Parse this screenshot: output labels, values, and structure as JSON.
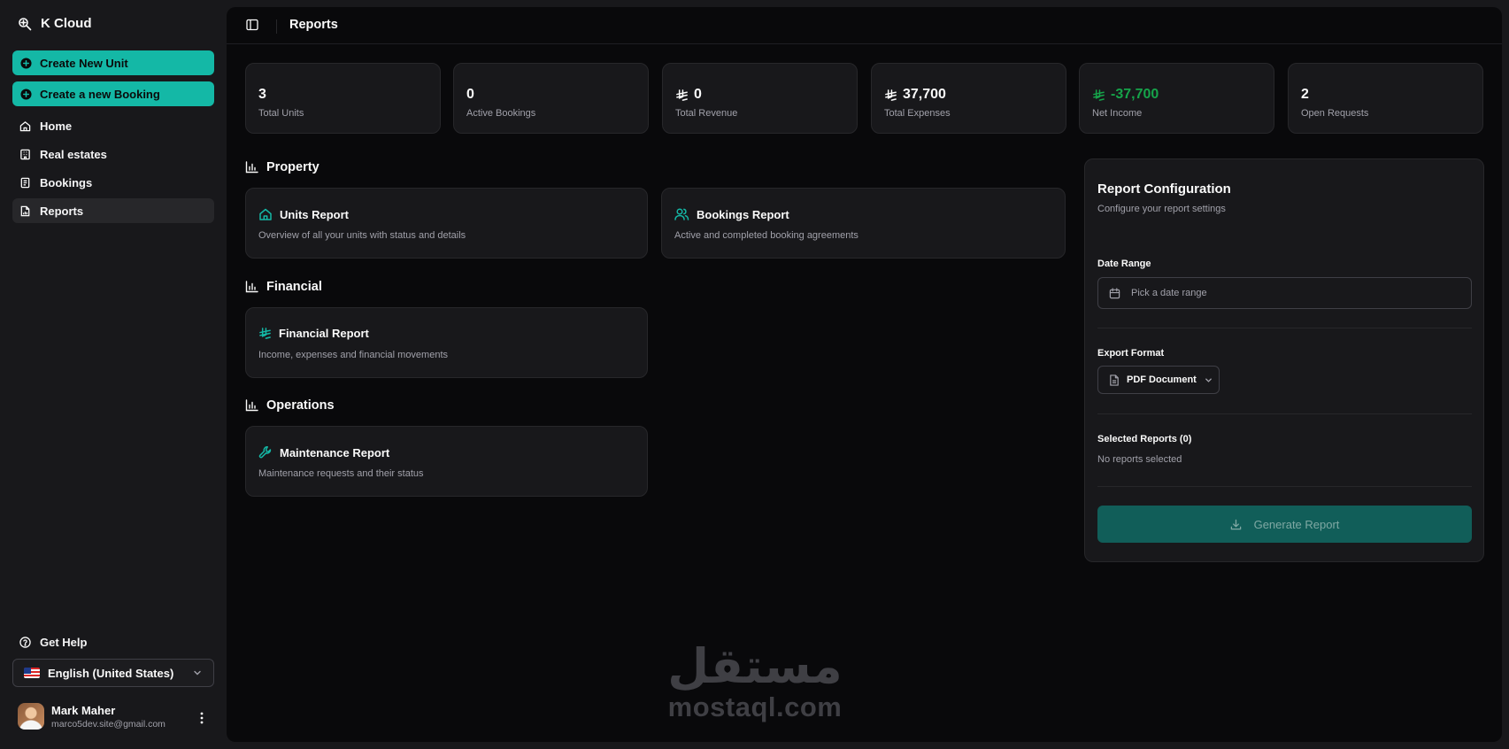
{
  "app": {
    "name": "K Cloud"
  },
  "sidebar": {
    "create_unit": "Create New Unit",
    "create_booking": "Create a new Booking",
    "items": [
      {
        "label": "Home",
        "icon": "house-icon"
      },
      {
        "label": "Real estates",
        "icon": "building-icon"
      },
      {
        "label": "Bookings",
        "icon": "book-icon"
      },
      {
        "label": "Reports",
        "icon": "report-icon",
        "active": true
      }
    ],
    "help": "Get Help",
    "language": "English (United States)",
    "user": {
      "name": "Mark Maher",
      "email": "marco5dev.site@gmail.com"
    }
  },
  "header": {
    "title": "Reports"
  },
  "stats": [
    {
      "value": "3",
      "label": "Total Units",
      "currency": false
    },
    {
      "value": "0",
      "label": "Active Bookings",
      "currency": false
    },
    {
      "value": "0",
      "label": "Total Revenue",
      "currency": true
    },
    {
      "value": "37,700",
      "label": "Total Expenses",
      "currency": true
    },
    {
      "value": "-37,700",
      "label": "Net Income",
      "currency": true,
      "color": "#16a34a"
    },
    {
      "value": "2",
      "label": "Open Requests",
      "currency": false
    }
  ],
  "sections": {
    "property": {
      "title": "Property",
      "cards": [
        {
          "title": "Units Report",
          "desc": "Overview of all your units with status and details",
          "icon": "house-icon"
        },
        {
          "title": "Bookings Report",
          "desc": "Active and completed booking agreements",
          "icon": "users-icon"
        }
      ]
    },
    "financial": {
      "title": "Financial",
      "cards": [
        {
          "title": "Financial Report",
          "desc": "Income, expenses and financial movements",
          "icon": "riyal-icon"
        }
      ]
    },
    "operations": {
      "title": "Operations",
      "cards": [
        {
          "title": "Maintenance Report",
          "desc": "Maintenance requests and their status",
          "icon": "wrench-icon"
        }
      ]
    }
  },
  "config": {
    "title": "Report Configuration",
    "subtitle": "Configure your report settings",
    "date_label": "Date Range",
    "date_placeholder": "Pick a date range",
    "format_label": "Export Format",
    "format_value": "PDF Document",
    "selected_label": "Selected Reports (0)",
    "selected_empty": "No reports selected",
    "generate": "Generate Report"
  },
  "watermark": {
    "arabic": "مستقل",
    "latin": "mostaql.com"
  },
  "colors": {
    "accent": "#14b8a6",
    "positive": "#16a34a",
    "background": "#09090b",
    "card": "#18181b"
  }
}
